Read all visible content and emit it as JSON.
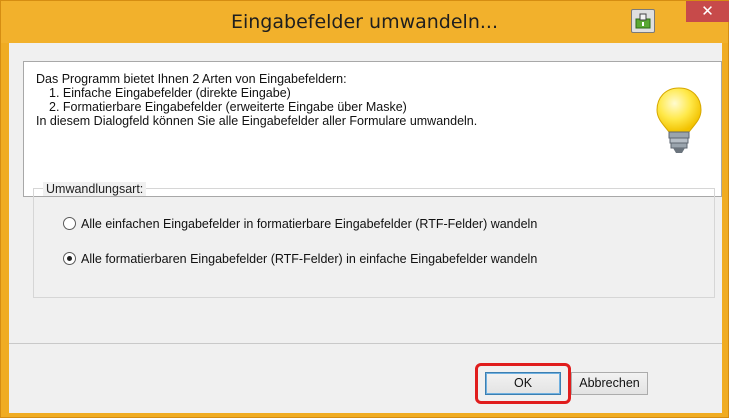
{
  "window": {
    "title": "Eingabefelder umwandeln...",
    "close_glyph": "✕",
    "pin_icon": "window-pin-icon"
  },
  "info": {
    "lines": [
      "Das Programm bietet Ihnen 2 Arten von Eingabefeldern:",
      "1. Einfache Eingabefelder (direkte Eingabe)",
      "2. Formatierbare Eingabefelder (erweiterte Eingabe über Maske)",
      "In diesem Dialogfeld können Sie alle Eingabefelder aller Formulare umwandeln."
    ],
    "icon": "lightbulb-icon"
  },
  "conversion": {
    "group_label": "Umwandlungsart:",
    "options": [
      {
        "label": "Alle einfachen Eingabefelder in formatierbare Eingabefelder (RTF-Felder) wandeln",
        "selected": false
      },
      {
        "label": "Alle formatierbaren Eingabefelder (RTF-Felder) in einfache Eingabefelder wandeln",
        "selected": true
      }
    ]
  },
  "buttons": {
    "ok_label": "OK",
    "cancel_label": "Abbrechen"
  },
  "colors": {
    "titlebar": "#f2b12c",
    "close_button": "#c74a4a",
    "highlight": "#e01d1d"
  }
}
